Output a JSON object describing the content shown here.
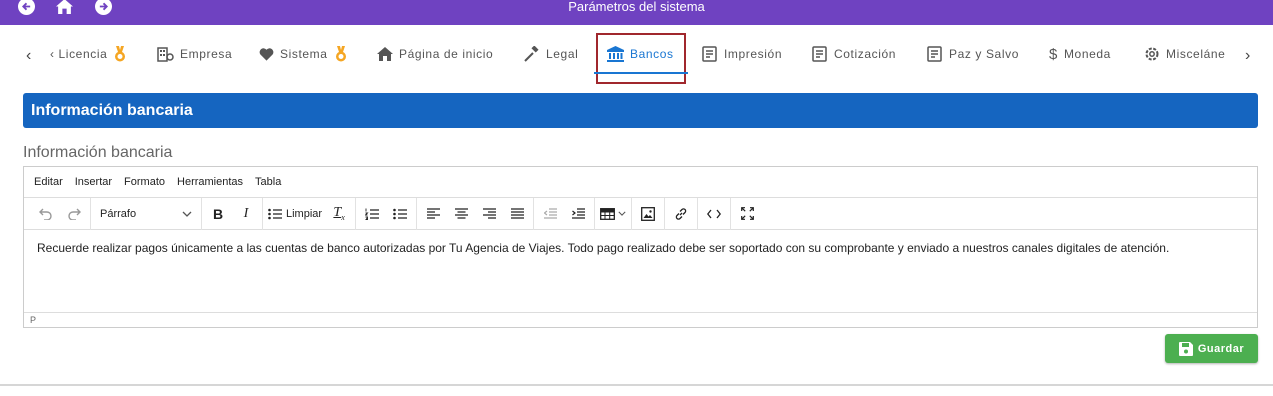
{
  "topbar": {
    "title": "Parámetros del sistema",
    "color": "#6f42c1"
  },
  "tabs": [
    {
      "label": "‹ Licencia",
      "icon": "medal-icon"
    },
    {
      "label": "Empresa",
      "icon": "building-icon"
    },
    {
      "label": "Sistema",
      "icon": "heart-icon"
    },
    {
      "label": "Página de inicio",
      "icon": "home-icon"
    },
    {
      "label": "Legal",
      "icon": "gavel-icon"
    },
    {
      "label": "Bancos",
      "icon": "bank-icon",
      "active": true
    },
    {
      "label": "Impresión",
      "icon": "receipt-icon"
    },
    {
      "label": "Cotización",
      "icon": "receipt-icon"
    },
    {
      "label": "Paz y Salvo",
      "icon": "receipt-icon"
    },
    {
      "label": "Moneda",
      "icon": "dollar-icon"
    },
    {
      "label": "Misceláne",
      "icon": "gear-icon"
    }
  ],
  "section": {
    "header": "Información bancaria",
    "field_label": "Información bancaria"
  },
  "editor": {
    "menu": [
      "Editar",
      "Insertar",
      "Formato",
      "Herramientas",
      "Tabla"
    ],
    "format_select": "Párrafo",
    "clear_label": "Limpiar",
    "content": "Recuerde realizar pagos únicamente a las cuentas de banco autorizadas por Tu Agencia de Viajes. Todo pago realizado debe ser soportado con su comprobante y enviado a nuestros canales digitales de atención.",
    "status_path": "P"
  },
  "save_button": {
    "label": "Guardar",
    "color": "#4caf50"
  },
  "colors": {
    "accent": "#1976d2",
    "header_bg": "#1565c0",
    "active_outline": "#a0272d"
  }
}
